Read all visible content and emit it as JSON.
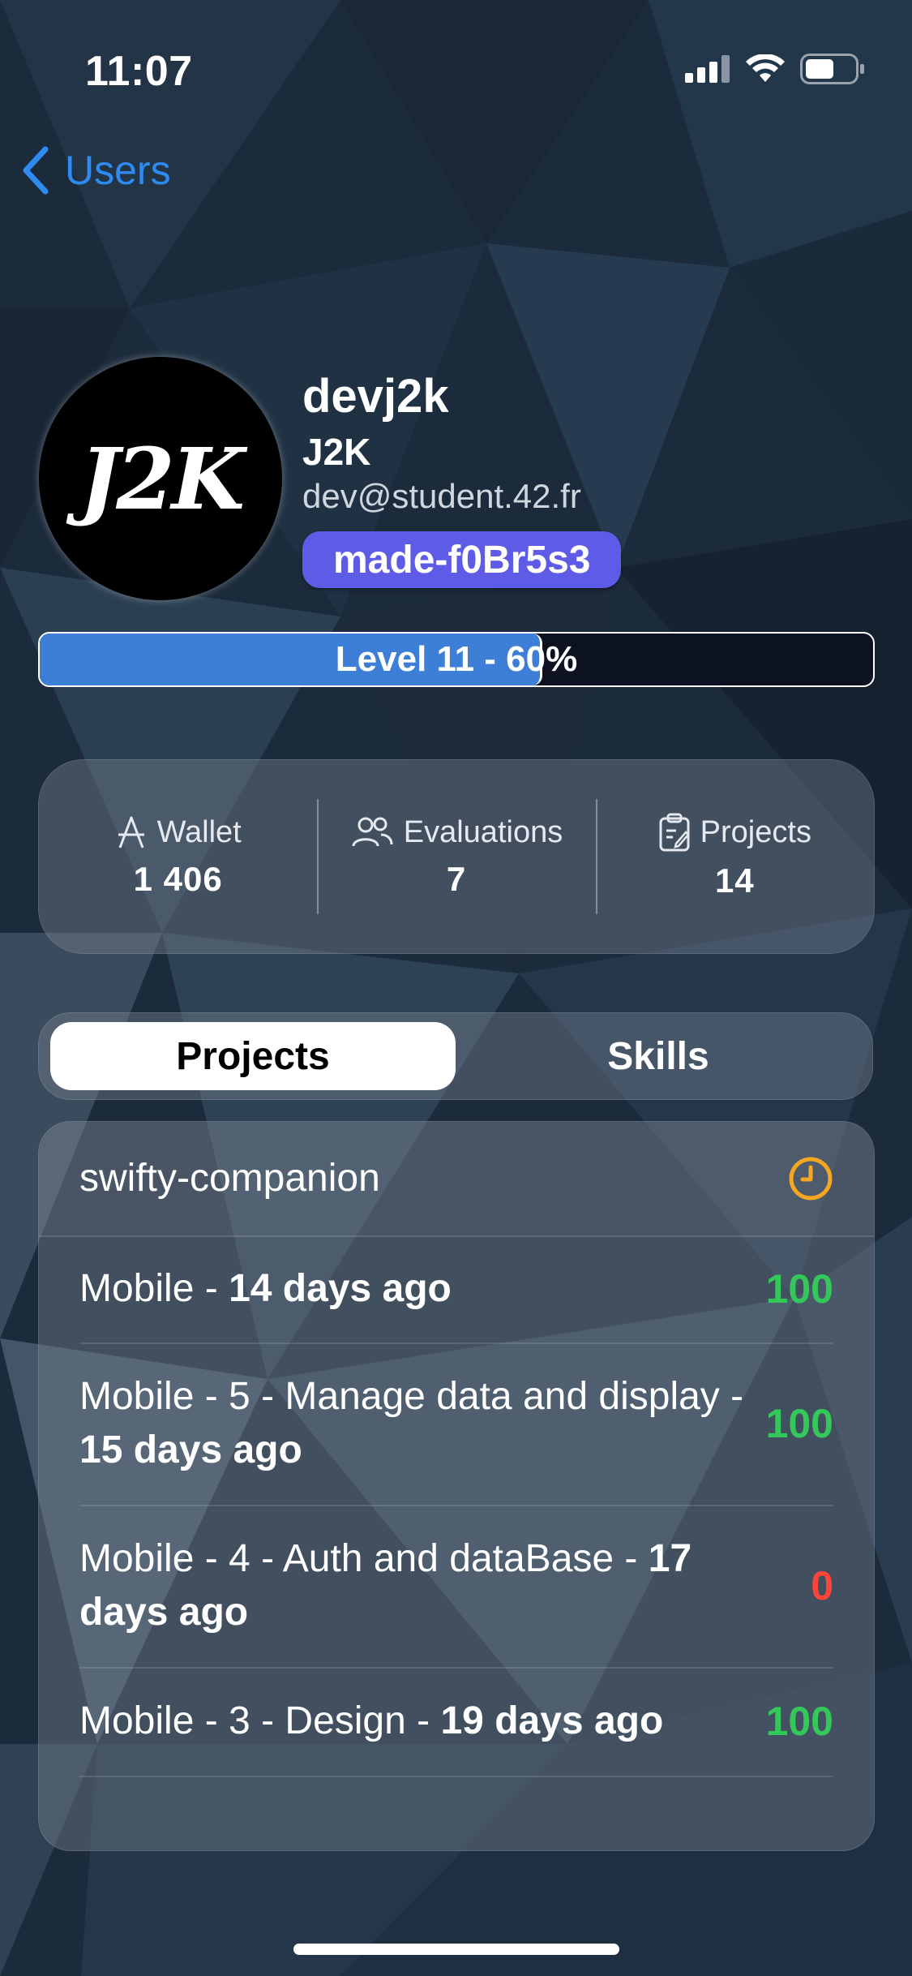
{
  "status_bar": {
    "time": "11:07"
  },
  "nav": {
    "back_label": "Users"
  },
  "profile": {
    "avatar_text": "J2K",
    "login": "devj2k",
    "name": "J2K",
    "email": "dev@student.42.fr",
    "badge": "made-f0Br5s3"
  },
  "level": {
    "label": "Level 11 - 60%",
    "progress_fraction": 0.6
  },
  "stats": [
    {
      "label": "Wallet",
      "value": "1 406",
      "icon": "currency-a-icon"
    },
    {
      "label": "Evaluations",
      "value": "7",
      "icon": "people-icon"
    },
    {
      "label": "Projects",
      "value": "14",
      "icon": "clipboard-icon"
    }
  ],
  "tabs": [
    {
      "label": "Projects",
      "active": true
    },
    {
      "label": "Skills",
      "active": false
    }
  ],
  "projects": {
    "current": {
      "name": "swifty-companion",
      "status_icon": "clock-icon"
    },
    "items": [
      {
        "name": "Mobile - ",
        "time": "14 days ago",
        "score": "100",
        "passed": true
      },
      {
        "name": "Mobile - 5 - Manage data and display - ",
        "time": "15 days ago",
        "score": "100",
        "passed": true
      },
      {
        "name": "Mobile - 4 - Auth and dataBase - ",
        "time": "17 days ago",
        "score": "0",
        "passed": false
      },
      {
        "name": "Mobile - 3 - Design - ",
        "time": "19 days ago",
        "score": "100",
        "passed": true
      }
    ]
  },
  "colors": {
    "accent": "#2e8cf0",
    "badge": "#5e5ce6",
    "success": "#34c759",
    "failure": "#ff453a",
    "pending": "#f5a623"
  }
}
